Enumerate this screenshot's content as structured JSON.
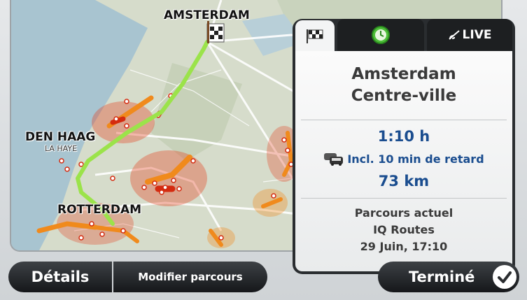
{
  "map": {
    "cities": {
      "amsterdam": "AMSTERDAM",
      "den_haag": "DEN HAAG",
      "la_haye": "LA HAYE",
      "rotterdam": "ROTTERDAM"
    }
  },
  "tabs": {
    "route_icon": "checkered-flag-icon",
    "time_icon": "clock-icon",
    "live_icon": "live-signal-icon",
    "live_label": "LIVE"
  },
  "destination": {
    "line1": "Amsterdam",
    "line2": "Centre-ville"
  },
  "trip": {
    "duration": "1:10 h",
    "delay": "Incl. 10 min de retard",
    "delay_icon": "traffic-cars-icon",
    "distance": "73 km"
  },
  "route_info": {
    "line1": "Parcours actuel",
    "line2": "IQ Routes",
    "line3": "29 Juin, 17:10"
  },
  "buttons": {
    "details": "Détails",
    "modify": "Modifier parcours",
    "done": "Terminé",
    "done_icon": "checkmark-icon"
  },
  "colors": {
    "route": "#9be34a",
    "traffic": "#e53b1a",
    "delay_text": "#1a4d8f"
  }
}
